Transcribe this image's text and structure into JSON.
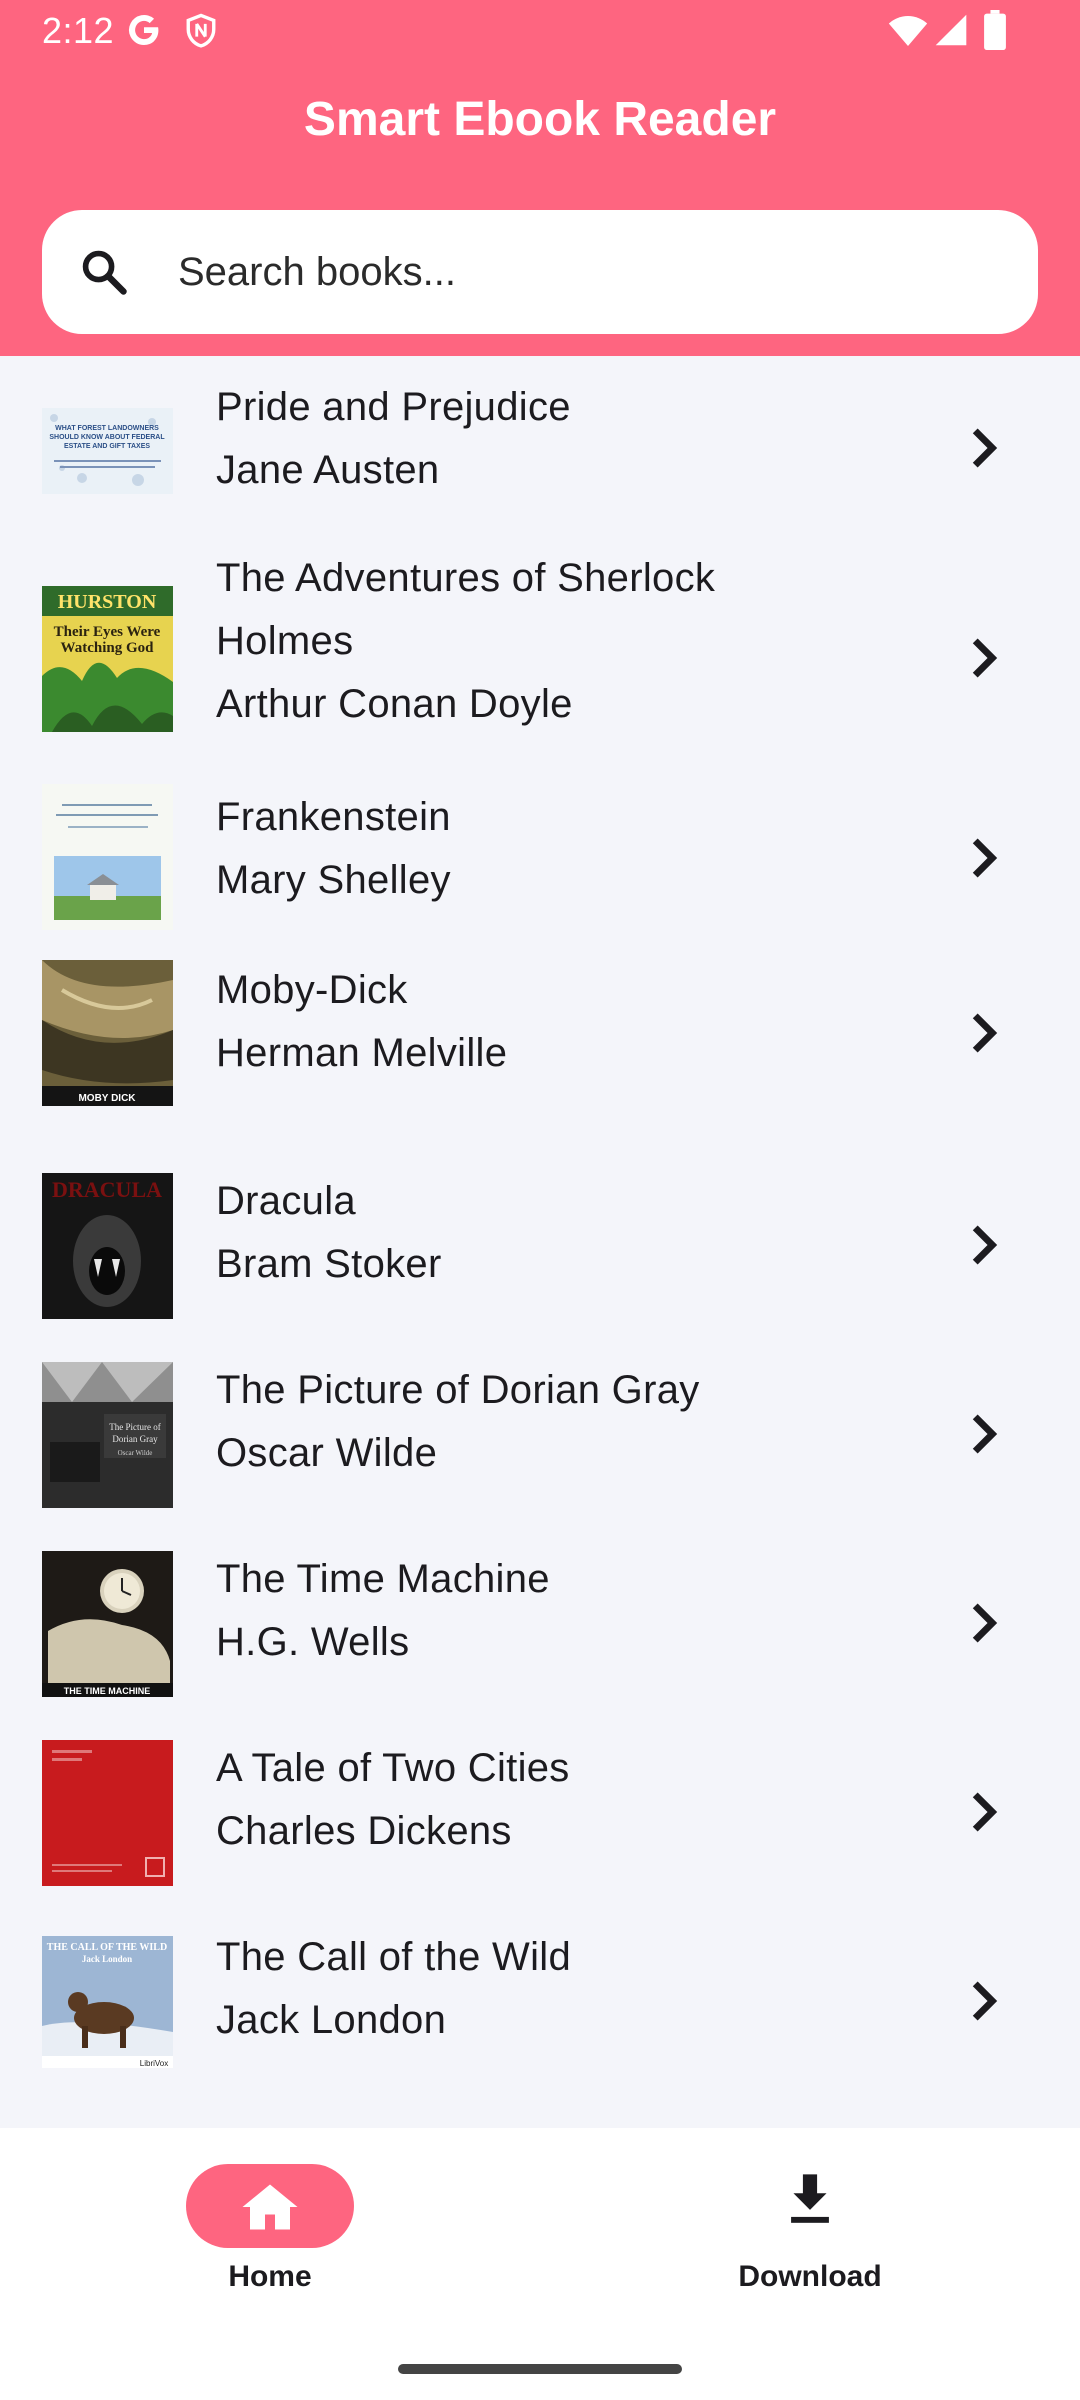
{
  "status_bar": {
    "time": "2:12"
  },
  "header": {
    "title": "Smart Ebook Reader"
  },
  "search": {
    "placeholder": "Search books..."
  },
  "books": [
    {
      "title": "Pride and Prejudice",
      "author": "Jane Austen"
    },
    {
      "title": "The Adventures of Sherlock Holmes",
      "author": "Arthur Conan Doyle"
    },
    {
      "title": "Frankenstein",
      "author": "Mary Shelley"
    },
    {
      "title": "Moby-Dick",
      "author": "Herman Melville"
    },
    {
      "title": "Dracula",
      "author": "Bram Stoker"
    },
    {
      "title": "The Picture of Dorian Gray",
      "author": "Oscar Wilde"
    },
    {
      "title": "The Time Machine",
      "author": "H.G. Wells"
    },
    {
      "title": "A Tale of Two Cities",
      "author": "Charles Dickens"
    },
    {
      "title": "The Call of the Wild",
      "author": "Jack London"
    }
  ],
  "covers": {
    "pride": "WHAT FOREST LANDOWNERS SHOULD KNOW ABOUT FEDERAL ESTATE AND GIFT TAXES",
    "sherlock_top": "HURSTON",
    "sherlock_sub": "Their Eyes Were Watching God",
    "moby": "MOBY DICK",
    "dracula": "DRACULA",
    "dorian": "The Picture of Dorian Gray",
    "dorian_author": "Oscar Wilde",
    "time": "THE TIME MACHINE",
    "wild": "THE CALL OF THE WILD",
    "wild_author": "Jack London",
    "wild_footer": "LibriVox"
  },
  "nav": {
    "home_label": "Home",
    "download_label": "Download"
  },
  "colors": {
    "primary": "#fe6580",
    "background": "#f4f5fa",
    "surface": "#ffffff",
    "text": "#1c1b1f"
  }
}
